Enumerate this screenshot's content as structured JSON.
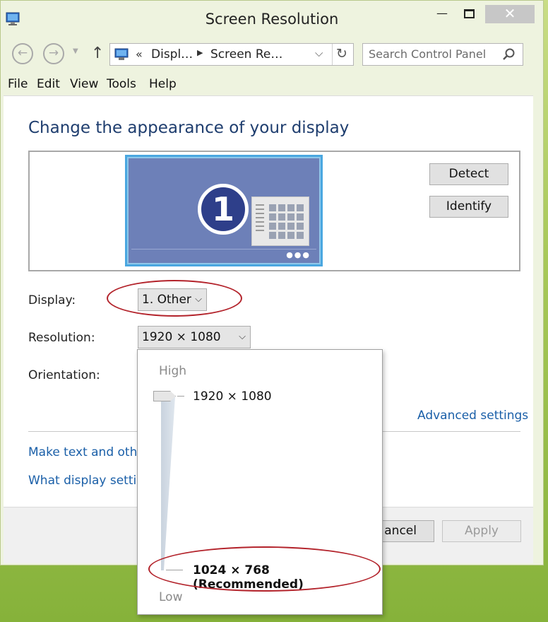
{
  "window": {
    "title": "Screen Resolution"
  },
  "nav": {
    "breadcrumb_prefix": "«",
    "crumbs": [
      "Displ…",
      "Screen Re…"
    ],
    "search_placeholder": "Search Control Panel"
  },
  "menu": [
    "File",
    "Edit",
    "View",
    "Tools",
    "Help"
  ],
  "main": {
    "heading": "Change the appearance of your display",
    "monitor_number": "1",
    "detect_label": "Detect",
    "identify_label": "Identify",
    "display_label": "Display:",
    "display_value": "1. Other",
    "resolution_label": "Resolution:",
    "resolution_value": "1920 × 1080",
    "orientation_label": "Orientation:",
    "advanced_link": "Advanced settings",
    "link_text_size": "Make text and othe",
    "link_what_display": "What display setting"
  },
  "footer": {
    "cancel_label": "ancel",
    "apply_label": "Apply"
  },
  "resolution_popup": {
    "high_label": "High",
    "low_label": "Low",
    "option_top": "1920 × 1080",
    "option_bottom": "1024 × 768 (Recommended)",
    "slider_level": 1.0
  },
  "colors": {
    "heading": "#1e3d6e",
    "link": "#1a5fa8",
    "annotation": "#b3232b",
    "monitor": "#6d80b8",
    "monitor_border": "#4aa7e0"
  },
  "icons": [
    "app-monitor-icon",
    "back-icon",
    "forward-icon",
    "up-arrow-icon",
    "refresh-icon",
    "search-icon",
    "close-icon",
    "minimize-icon",
    "maximize-icon",
    "chevron-down-icon"
  ]
}
